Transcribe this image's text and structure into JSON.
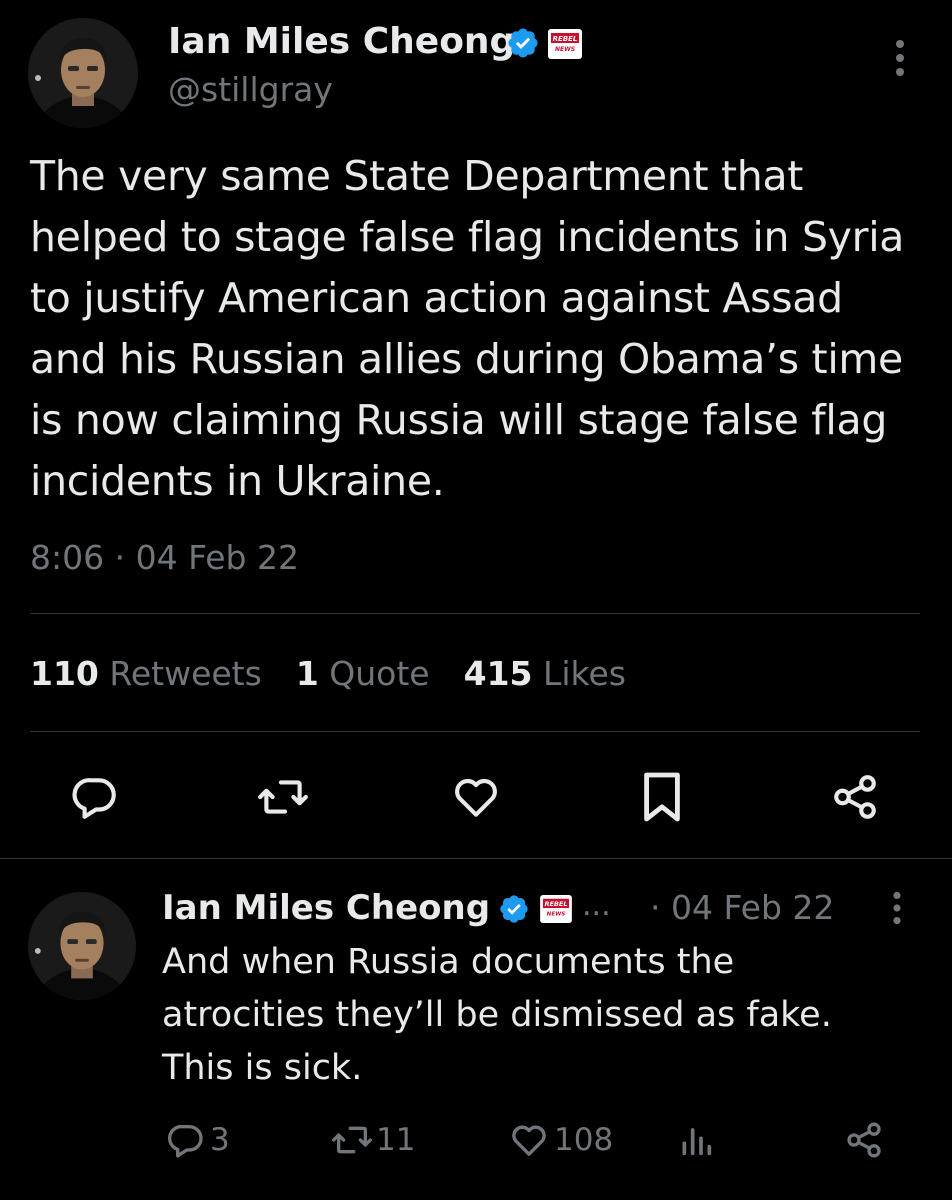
{
  "tweet": {
    "author_name": "Ian Miles Cheong",
    "author_handle": "@stillgray",
    "badge_text": "REBEL NEWS",
    "text": "The very same State Department that helped to stage false flag incidents in Syria to justify American action against Assad and his Russian allies during Obama’s time is now claiming Russia will stage false flag incidents in Ukraine.",
    "time": "8:06",
    "date": "04 Feb 22",
    "stats": {
      "retweets_count": "110",
      "retweets_label": "Retweets",
      "quotes_count": "1",
      "quotes_label": "Quote",
      "likes_count": "415",
      "likes_label": "Likes"
    }
  },
  "reply": {
    "author_name": "Ian Miles Cheong",
    "ellipsis": "...",
    "date": "04 Feb 22",
    "text_lines": [
      "And when Russia documents the",
      "atrocities they’ll be dismissed as fake.",
      "This is sick."
    ],
    "replies_count": "3",
    "retweets_count": "11",
    "likes_count": "108"
  },
  "colors": {
    "background": "#000000",
    "text_primary": "#e7e9ea",
    "text_secondary": "#71767b",
    "divider": "#2f3336",
    "verified": "#1d9bf0",
    "badge_red": "#c8102e"
  },
  "icons": {
    "more": "more-icon",
    "reply": "reply-icon",
    "retweet": "retweet-icon",
    "like": "like-icon",
    "bookmark": "bookmark-icon",
    "share": "share-icon",
    "views": "views-icon",
    "verified": "verified-badge-icon"
  }
}
